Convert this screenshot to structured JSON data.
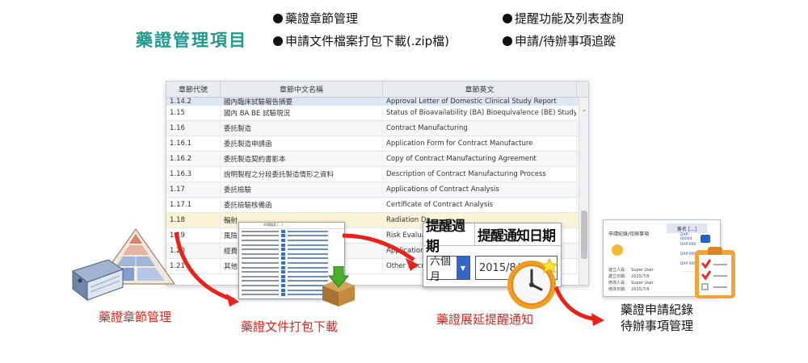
{
  "header": {
    "title": "藥證管理項目",
    "bullets": [
      "藥證章節管理",
      "提醒功能及列表查詢",
      "申請文件檔案打包下載(.zip檔)",
      "申請/待辦事項追蹤"
    ]
  },
  "table": {
    "columns": [
      "章節代號",
      "章節中文名稱",
      "章節英文"
    ],
    "cut_row": [
      "1.14.2",
      "國內臨床試驗報告摘要",
      "Approval Letter of Domestic Clinical Study Report"
    ],
    "rows": [
      [
        "1.15",
        "國內 BA BE 試驗現況",
        "Status of Bioavailability (BA) Bioequivalence (BE) Study T..."
      ],
      [
        "1.16",
        "委託製造",
        "Contract Manufacturing"
      ],
      [
        "1.16.1",
        "委託製造申請函",
        "Application Form for Contract Manufacture"
      ],
      [
        "1.16.2",
        "委託製造契約書影本",
        "Copy of Contract Manufacturing Agreement"
      ],
      [
        "1.16.3",
        "說明製程之分段委託製造情形之資料",
        "Description of Contract Manufacturing Process"
      ],
      [
        "1.17",
        "委託檢驗",
        "Applications of Contract Analysis"
      ],
      [
        "1.17.1",
        "委託檢驗核備函",
        "Certificate of Contract Analysis"
      ],
      [
        "1.18",
        "輻射",
        "Radiation Do..."
      ],
      [
        "1.19",
        "風險",
        "Risk Evaluat..."
      ],
      [
        "1.20",
        "經費",
        "Application f..."
      ],
      [
        "1.21",
        "其他",
        "Other Docu..."
      ]
    ],
    "highlight_row": "1.18"
  },
  "reminder": {
    "col1": "提醒週期",
    "col2": "提醒通知日期",
    "period_value": "六個月",
    "date_value": "2015/8/3"
  },
  "record": {
    "title": "申請紀錄/待辦事項",
    "grid_header": "簽名 [...]",
    "info": "建立人員：  Super User\n建立日期：  2015/7/6\n修改人員：  Super User\n修改日期：  2015/7/6",
    "col_items": [
      "DAP-00004",
      "DAP-000",
      "DAP-000",
      "DAP-000"
    ]
  },
  "doclist": {
    "header": "申請檔案 [...]"
  },
  "captions": {
    "chapter": "藥證章節管理",
    "download": "藥證文件打包下載",
    "extend": "藥證展延提醒通知",
    "apply_line1": "藥證申請紀錄",
    "apply_line2": "待辦事項管理"
  },
  "colors": {
    "title": "#1f9a8e",
    "caption": "#e0251c",
    "arrow": "#e8231a",
    "highlight": "#fbf3d6"
  }
}
